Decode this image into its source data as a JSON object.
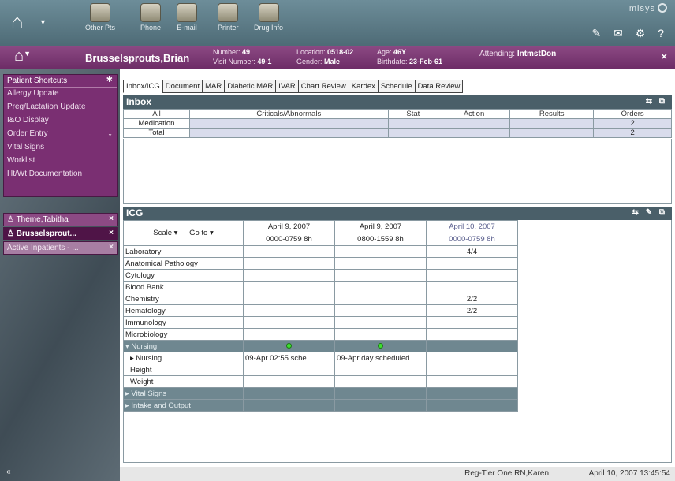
{
  "toolbar": {
    "items": [
      {
        "label": "Other Pts",
        "icon": "other-patients-icon"
      },
      {
        "label": "Phone",
        "icon": "phone-icon"
      },
      {
        "label": "E-mail",
        "icon": "email-icon"
      },
      {
        "label": "Printer",
        "icon": "printer-icon"
      },
      {
        "label": "Drug Info",
        "icon": "drug-info-icon"
      }
    ],
    "brand": "misys",
    "tools": "✎ ✉ ⚙ ?"
  },
  "banner": {
    "name": "Brusselsprouts,Brian",
    "number_label": "Number:",
    "number": "49",
    "visit_label": "Visit Number:",
    "visit": "49-1",
    "location_label": "Location:",
    "location": "0518-02",
    "gender_label": "Gender:",
    "gender": "Male",
    "age_label": "Age:",
    "age": "46Y",
    "birthdate_label": "Birthdate:",
    "birthdate": "23-Feb-61",
    "attending_label": "Attending:",
    "attending": "IntmstDon",
    "close": "×"
  },
  "sidebar": {
    "shortcuts_title": "Patient Shortcuts",
    "shortcuts": [
      {
        "label": "Allergy Update"
      },
      {
        "label": "Preg/Lactation Update"
      },
      {
        "label": "I&O Display"
      },
      {
        "label": "Order Entry",
        "chevron": "⌄"
      },
      {
        "label": "Vital Signs"
      },
      {
        "label": "Worklist"
      },
      {
        "label": "Ht/Wt Documentation"
      }
    ],
    "patients": [
      {
        "label": "Theme,Tabitha"
      },
      {
        "label": "Brusselsprout..."
      },
      {
        "label": "Active Inpatients - ..."
      }
    ],
    "collapse": "«"
  },
  "tabs": [
    "Inbox/ICG",
    "Document",
    "MAR",
    "Diabetic MAR",
    "IVAR",
    "Chart Review",
    "Kardex",
    "Schedule",
    "Data Review"
  ],
  "inbox": {
    "title": "Inbox",
    "tools": "⇆ ⧉",
    "columns": [
      "All",
      "Criticals/Abnormals",
      "Stat",
      "Action",
      "Results",
      "Orders"
    ],
    "rows": [
      {
        "label": "Medication",
        "cells": [
          "",
          "",
          "",
          "",
          "2"
        ]
      },
      {
        "label": "Total",
        "cells": [
          "",
          "",
          "",
          "",
          "2"
        ]
      }
    ]
  },
  "icg": {
    "title": "ICG",
    "tools": "⇆ ✎ ⧉",
    "scale": "Scale ▾",
    "goto": "Go to ▾",
    "columns": [
      {
        "date": "April 9, 2007",
        "range": "0000-0759 8h"
      },
      {
        "date": "April 9, 2007",
        "range": "0800-1559 8h"
      },
      {
        "date": "April 10, 2007",
        "range": "0000-0759 8h"
      }
    ],
    "rows": [
      {
        "label": "Laboratory",
        "cells": [
          "",
          "",
          "4/4"
        ]
      },
      {
        "label": "Anatomical Pathology",
        "cells": [
          "",
          "",
          ""
        ]
      },
      {
        "label": "Cytology",
        "cells": [
          "",
          "",
          ""
        ]
      },
      {
        "label": "Blood Bank",
        "cells": [
          "",
          "",
          ""
        ]
      },
      {
        "label": "Chemistry",
        "cells": [
          "",
          "",
          "2/2"
        ]
      },
      {
        "label": "Hematology",
        "cells": [
          "",
          "",
          "2/2"
        ]
      },
      {
        "label": "Immunology",
        "cells": [
          "",
          "",
          ""
        ]
      },
      {
        "label": "Microbiology",
        "cells": [
          "",
          "",
          ""
        ]
      }
    ],
    "nursing_group": {
      "label": "▾ Nursing"
    },
    "nursing_rows": [
      {
        "label": "▸ Nursing",
        "cells": [
          "09-Apr 02:55 sche...",
          "09-Apr day scheduled",
          ""
        ]
      },
      {
        "label": "Height",
        "cells": [
          "",
          "",
          ""
        ]
      },
      {
        "label": "Weight",
        "cells": [
          "",
          "",
          ""
        ]
      }
    ],
    "collapsed_groups": [
      {
        "label": "▸ Vital Signs"
      },
      {
        "label": "▸ Intake and Output"
      }
    ]
  },
  "status": {
    "user": "Reg-Tier One RN,Karen",
    "time": "April 10, 2007 13:45:54"
  }
}
